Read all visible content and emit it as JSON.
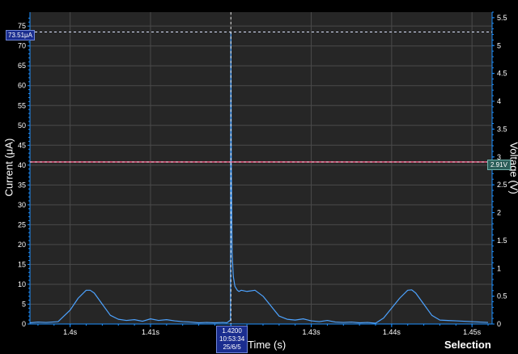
{
  "chart_data": {
    "type": "line",
    "xlabel": "Time (s)",
    "ylabel_left": "Current (μA)",
    "ylabel_right": "Voltage (V)",
    "xlim": [
      1.395,
      1.4525
    ],
    "ylim_left": [
      0,
      78.5
    ],
    "ylim_right": [
      0,
      5.6
    ],
    "x_ticks": [
      1.4,
      1.41,
      1.42,
      1.43,
      1.44,
      1.45
    ],
    "x_tick_labels": [
      "1.4s",
      "1.41s",
      "",
      "1.43s",
      "1.44s",
      "1.45s"
    ],
    "y_left_ticks": [
      0,
      5,
      10,
      15,
      20,
      25,
      30,
      35,
      40,
      45,
      50,
      55,
      60,
      65,
      70,
      75
    ],
    "y_right_ticks": [
      0,
      0.5,
      1,
      1.5,
      2,
      2.5,
      3,
      3.5,
      4,
      4.5,
      5,
      5.5
    ],
    "grid": true,
    "series": [
      {
        "axis": "left",
        "color": "#4da3ff",
        "x": [
          1.395,
          1.396,
          1.397,
          1.3985,
          1.4,
          1.401,
          1.402,
          1.4025,
          1.403,
          1.404,
          1.405,
          1.406,
          1.407,
          1.408,
          1.409,
          1.41,
          1.411,
          1.412,
          1.413,
          1.414,
          1.415,
          1.416,
          1.417,
          1.418,
          1.419,
          1.4195,
          1.41995,
          1.42,
          1.42005,
          1.42015,
          1.4203,
          1.4205,
          1.4208,
          1.421,
          1.4213,
          1.422,
          1.423,
          1.424,
          1.425,
          1.426,
          1.427,
          1.428,
          1.429,
          1.43,
          1.431,
          1.432,
          1.433,
          1.434,
          1.435,
          1.436,
          1.437,
          1.438,
          1.439,
          1.44,
          1.441,
          1.442,
          1.4425,
          1.443,
          1.444,
          1.445,
          1.446,
          1.447,
          1.448,
          1.449,
          1.45,
          1.451,
          1.452
        ],
        "y": [
          0.3,
          0.5,
          0.4,
          0.6,
          3.5,
          6.5,
          8.5,
          8.5,
          7.8,
          5,
          2.2,
          1.2,
          0.9,
          1.1,
          0.7,
          1.3,
          0.9,
          1.1,
          0.8,
          0.6,
          0.5,
          0.3,
          0.4,
          0.3,
          0.4,
          0.3,
          1,
          73.5,
          40,
          18,
          12,
          9.5,
          8.5,
          8.2,
          8.5,
          8.2,
          8.5,
          7,
          4.5,
          2,
          1.2,
          1,
          1.3,
          0.8,
          0.6,
          0.9,
          0.5,
          0.4,
          0.5,
          0.3,
          0.4,
          0.2,
          1.5,
          4,
          6.5,
          8.5,
          8.6,
          7.8,
          5,
          2.2,
          1,
          0.9,
          0.8,
          0.7,
          0.6,
          0.5,
          0.4
        ]
      },
      {
        "axis": "right",
        "color": "#ff5c8a",
        "x": [
          1.395,
          1.4525
        ],
        "y": [
          2.91,
          2.91
        ]
      }
    ]
  },
  "cursors": {
    "y_value": 73.51,
    "y_label": "73.51μA",
    "x_value": 1.42,
    "x_label": [
      "1.4200",
      "10:53:34",
      "25/6/5"
    ],
    "v_value": 2.91,
    "v_label": "2.91V"
  },
  "footer": {
    "selection_label": "Selection"
  },
  "colors": {
    "plot_bg": "#262626",
    "grid": "#4a4a4a",
    "axis": "#1e90ff",
    "current": "#4da3ff",
    "voltage": "#ff5c8a",
    "cursor_h": "#dde6ff",
    "cursor_v": "#ffffff"
  }
}
